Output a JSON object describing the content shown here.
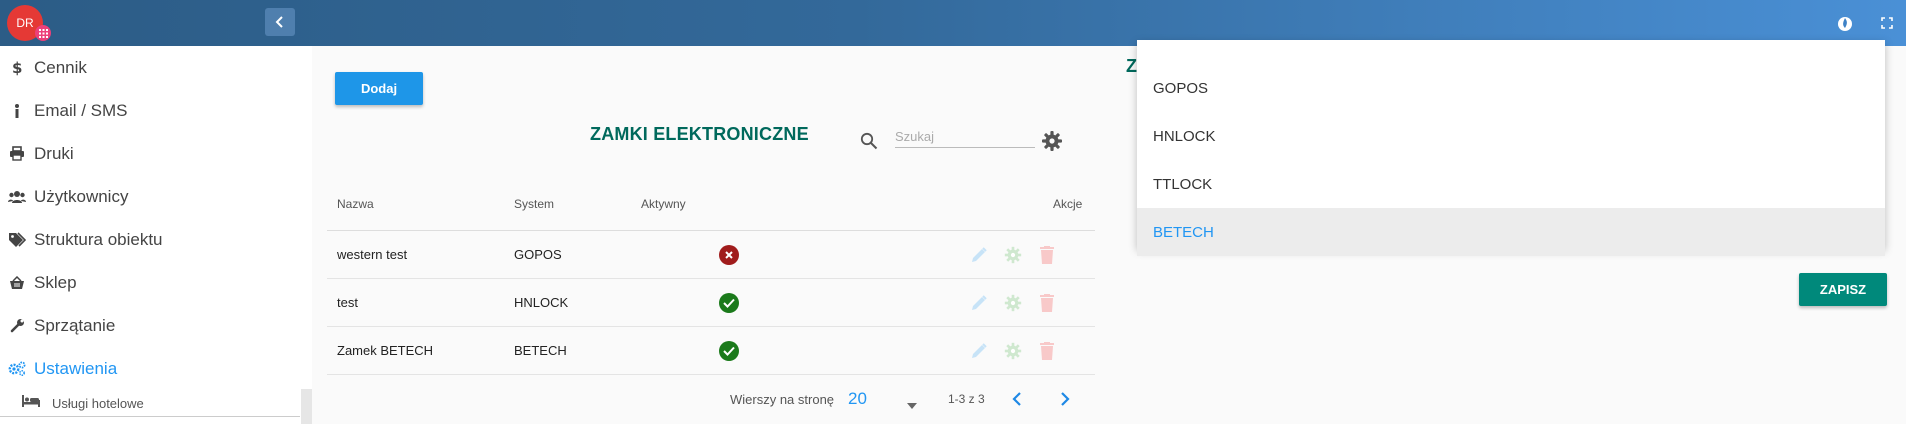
{
  "header": {
    "avatar_initials": "DR"
  },
  "sidebar": {
    "items": [
      {
        "label": "Cennik",
        "icon": "dollar-icon"
      },
      {
        "label": "Email / SMS",
        "icon": "info-icon"
      },
      {
        "label": "Druki",
        "icon": "printer-icon"
      },
      {
        "label": "Użytkownicy",
        "icon": "users-icon"
      },
      {
        "label": "Struktura obiektu",
        "icon": "tags-icon"
      },
      {
        "label": "Sklep",
        "icon": "basket-icon"
      },
      {
        "label": "Sprzątanie",
        "icon": "wrench-icon"
      },
      {
        "label": "Ustawienia",
        "icon": "cogs-icon",
        "active": true
      }
    ],
    "sub_item": {
      "label": "Usługi hotelowe",
      "icon": "bed-icon"
    }
  },
  "main": {
    "add_label": "Dodaj",
    "title": "ZAMKI ELEKTRONICZNE",
    "search_placeholder": "Szukaj",
    "table": {
      "headers": {
        "name": "Nazwa",
        "system": "System",
        "active": "Aktywny",
        "actions": "Akcje"
      },
      "rows": [
        {
          "name": "western test",
          "system": "GOPOS",
          "active": false
        },
        {
          "name": "test",
          "system": "HNLOCK",
          "active": true
        },
        {
          "name": "Zamek BETECH",
          "system": "BETECH",
          "active": true
        }
      ]
    },
    "pagination": {
      "rows_per_page_label": "Wierszy na stronę",
      "rows_per_page": "20",
      "range": "1-3 z 3"
    }
  },
  "dialog": {
    "title_peek": "Z",
    "save_label": "ZAPISZ",
    "dropdown_options": [
      "GOPOS",
      "HNLOCK",
      "TTLOCK",
      "BETECH"
    ],
    "selected_option": "BETECH"
  },
  "colors": {
    "accent": "#2196f3",
    "title": "#00695c",
    "save": "#00897b",
    "active_ok": "#1b7a1b",
    "inactive": "#a01c1c"
  }
}
